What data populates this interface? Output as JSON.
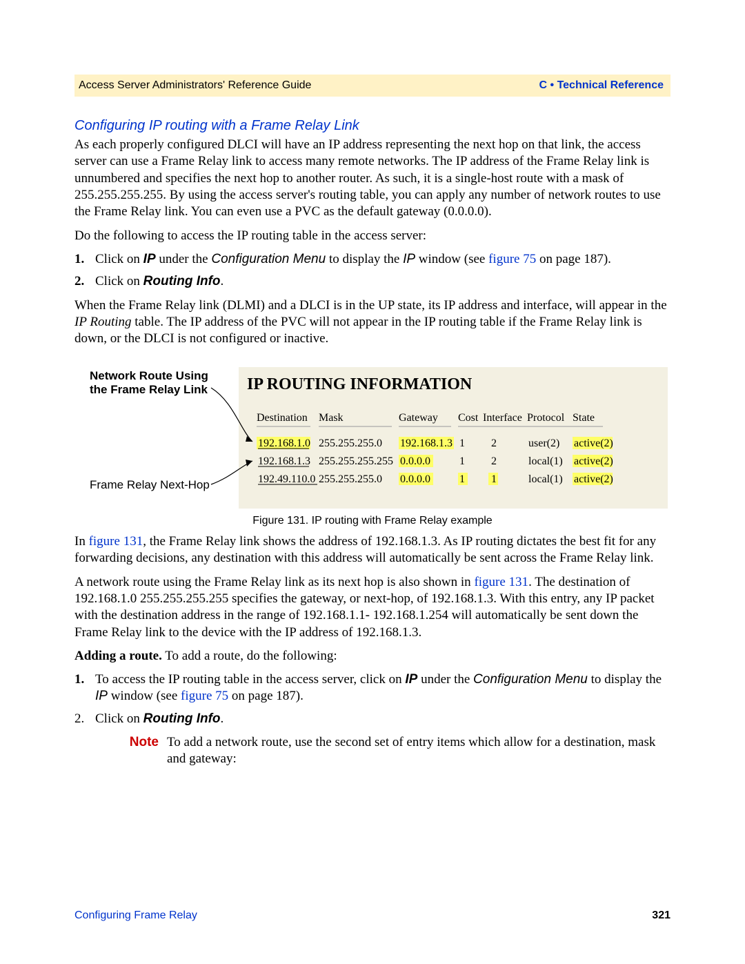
{
  "header": {
    "left": "Access Server Administrators' Reference Guide",
    "right": "C • Technical Reference"
  },
  "section_title": "Configuring IP routing with a Frame Relay Link",
  "para1": "As each properly configured DLCI will have an IP address representing the next hop on that link, the access server can use a Frame Relay link to access many remote networks. The IP address of the Frame Relay link is unnumbered and specifies the next hop to another router. As such, it is a single-host route with a mask of 255.255.255.255. By using the access server's routing table, you can apply any number of network routes to use the Frame Relay link. You can even use a PVC as the default gateway (0.0.0.0).",
  "para2": "Do the following to access the IP routing table in the access server:",
  "list1": {
    "item1_a": "Click on ",
    "item1_ip": "IP",
    "item1_b": " under the ",
    "item1_cm": "Configuration Menu",
    "item1_c": " to display the ",
    "item1_ipw": "IP",
    "item1_d": " window (see ",
    "item1_link": "figure 75",
    "item1_e": " on page 187).",
    "item2_a": "Click on ",
    "item2_ri": "Routing Info",
    "item2_b": "."
  },
  "para3_a": "When the Frame Relay link (DLMI) and a DLCI is in the UP state, its IP address and interface, will appear in the ",
  "para3_ital": "IP Routing",
  "para3_b": " table. The IP address of the PVC will not appear in the IP routing table if the Frame Relay link is down, or the DLCI is not configured or inactive.",
  "figure": {
    "ann1a": "Network Route Using",
    "ann1b": "the Frame Relay Link",
    "ann2": "Frame Relay Next-Hop",
    "title": "IP ROUTING INFORMATION",
    "headers": [
      "Destination",
      "Mask",
      "Gateway",
      "Cost",
      "Interface",
      "Protocol",
      "State"
    ],
    "rows": [
      {
        "dest": "192.168.1.0",
        "mask": "255.255.255.0",
        "gw": "192.168.1.3",
        "cost": "1",
        "iface": "2",
        "proto": "user(2)",
        "state": "active(2)"
      },
      {
        "dest": "192.168.1.3",
        "mask": "255.255.255.255",
        "gw": "0.0.0.0",
        "cost": "1",
        "iface": "2",
        "proto": "local(1)",
        "state": "active(2)"
      },
      {
        "dest": "192.49.110.0",
        "mask": "255.255.255.0",
        "gw": "0.0.0.0",
        "cost": "1",
        "iface": "1",
        "proto": "local(1)",
        "state": "active(2)"
      }
    ],
    "caption": "Figure 131. IP routing with Frame Relay example"
  },
  "para4_a": "In ",
  "para4_link": "figure 131",
  "para4_b": ", the Frame Relay link shows the address of 192.168.1.3. As IP routing dictates the best fit for any forwarding decisions, any destination with this address will automatically be sent across the Frame Relay link.",
  "para5_a": "A network route using the Frame Relay link as its next hop is also shown in ",
  "para5_link": "figure 131",
  "para5_b": ". The destination of 192.168.1.0 255.255.255.255 specifies the gateway, or next-hop, of 192.168.1.3. With this entry, any IP packet with the destination address in the range of 192.168.1.1- 192.168.1.254 will automatically be sent down the Frame Relay link to the device with the IP address of 192.168.1.3.",
  "para6_bold": "Adding a route.",
  "para6_rest": " To add a route, do the following:",
  "list2": {
    "item1_a": "To access the IP routing table in the access server, click on ",
    "item1_ip": "IP",
    "item1_b": " under the ",
    "item1_cm": "Configuration Menu",
    "item1_c": " to display the ",
    "item1_ipw": "IP",
    "item1_d": " window (see ",
    "item1_link": "figure 75",
    "item1_e": " on page 187).",
    "item2_a": "Click on ",
    "item2_ri": "Routing Info",
    "item2_b": "."
  },
  "note": {
    "label": "Note",
    "text": "To add a network route, use the second set of entry items which allow for a destination, mask and gateway:"
  },
  "footer": {
    "left": "Configuring Frame Relay",
    "right": "321"
  }
}
